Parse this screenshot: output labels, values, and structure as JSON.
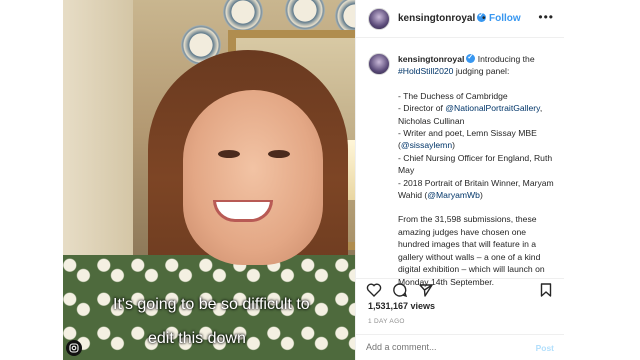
{
  "video": {
    "caption_line1": "It's going to be so difficult to",
    "caption_line2": "edit this down"
  },
  "header": {
    "username": "kensingtonroyal",
    "separator": "•",
    "follow_label": "Follow",
    "more_label": "•••"
  },
  "post": {
    "username": "kensingtonroyal",
    "intro_text": "Introducing the",
    "hashtag": "#HoldStill2020",
    "intro_tail": "judging panel:",
    "panel": [
      {
        "prefix": "- ",
        "text": "The Duchess of Cambridge",
        "link": "",
        "suffix": ""
      },
      {
        "prefix": "- Director of ",
        "text": "",
        "link": "@NationalPortraitGallery",
        "suffix": ", Nicholas Cullinan"
      },
      {
        "prefix": "- Writer and poet, Lemn Sissay MBE (",
        "text": "",
        "link": "@sissaylemn",
        "suffix": ")"
      },
      {
        "prefix": "- Chief Nursing Officer for England, Ruth May",
        "text": "",
        "link": "",
        "suffix": ""
      },
      {
        "prefix": "- 2018 Portrait of Britain Winner, Maryam Wahid (",
        "text": "",
        "link": "@MaryamWb",
        "suffix": ")"
      }
    ],
    "closing": "From the 31,598 submissions, these amazing judges have chosen one hundred images that will feature in a gallery without walls – a one of a kind digital exhibition – which will launch on Monday 14th September."
  },
  "stats": {
    "views": "1,531,167 views",
    "time_ago": "1 DAY AGO"
  },
  "comment": {
    "placeholder": "Add a comment...",
    "post_label": "Post"
  },
  "colors": {
    "accent": "#3897f0",
    "link": "#003569",
    "muted": "#8e8e8e"
  },
  "icons": [
    "heart-icon",
    "comment-icon",
    "share-icon",
    "bookmark-icon",
    "instagram-icon",
    "verified-icon",
    "more-icon"
  ]
}
